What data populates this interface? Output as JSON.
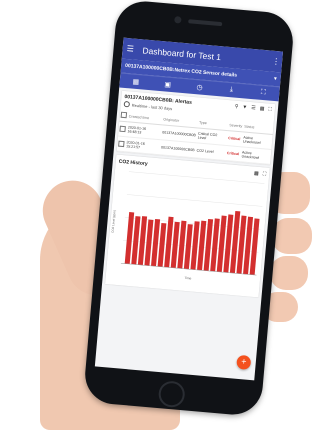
{
  "appbar": {
    "title": "Dashboard for Test 1",
    "menu_icon": "menu-icon",
    "more_icon": "more-vert-icon"
  },
  "subbar": {
    "device": "00137A100000CB0B:Netrex CO2 Sensor details"
  },
  "toolbar": {
    "icons": [
      "grid-icon",
      "camera-icon",
      "clock-icon",
      "download-icon",
      "fullscreen-icon"
    ]
  },
  "alerts": {
    "title": "00137A100000CB0B: Alertas",
    "realtime": "Realtime - last 30 days",
    "headers": [
      "Created time",
      "Originator",
      "Type",
      "Severity",
      "Status"
    ],
    "rows": [
      {
        "time": "2020-01-16 16:48:13",
        "originator": "00137A100000CB0B",
        "type": "Critical CO2 Level",
        "severity": "Critical",
        "status": "Active Unacknowl"
      },
      {
        "time": "2020-01-16 15:21:57",
        "originator": "00137A100000CB0B",
        "type": "CO2 Level",
        "severity": "Critical",
        "status": "Active Unacknowl"
      }
    ]
  },
  "chart": {
    "title": "CO2 History"
  },
  "chart_data": {
    "type": "bar",
    "values": [
      900,
      840,
      850,
      800,
      820,
      760,
      880,
      800,
      830,
      780,
      840,
      860,
      900,
      920,
      980,
      1010,
      1080,
      1010,
      1000,
      980
    ],
    "ylabel": "CO2 Level (ppm)",
    "xlabel": "Time",
    "ylim": [
      0,
      1600
    ],
    "bar_color": "#d32f2f",
    "grid": true
  },
  "colors": {
    "primary": "#3f51b5",
    "appbar": "#3949ab",
    "critical": "#d32f2f",
    "fab": "#f4511e"
  }
}
